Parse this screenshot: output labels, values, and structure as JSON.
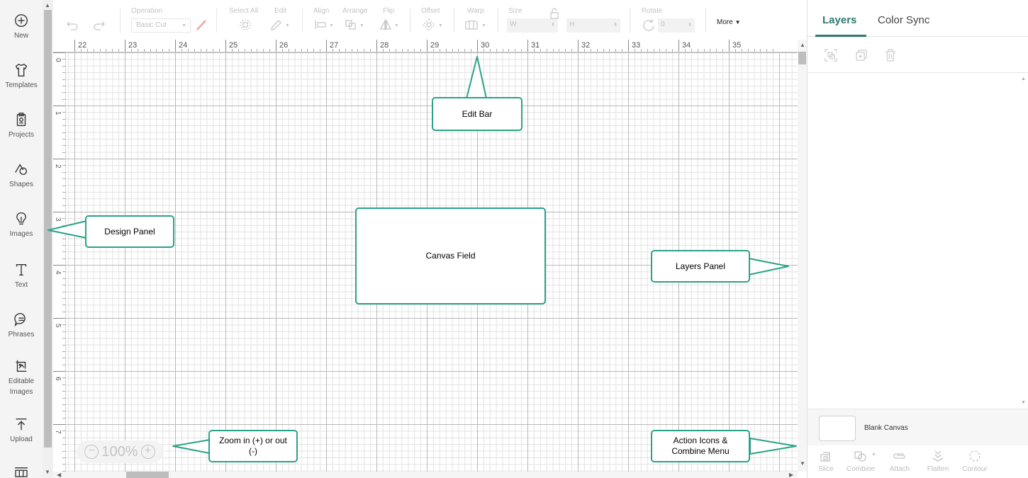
{
  "sidebar": {
    "items": [
      {
        "label": "New",
        "icon": "plus-circle-icon"
      },
      {
        "label": "Templates",
        "icon": "tshirt-icon"
      },
      {
        "label": "Projects",
        "icon": "clipboard-icon"
      },
      {
        "label": "Shapes",
        "icon": "shapes-icon"
      },
      {
        "label": "Images",
        "icon": "lightbulb-icon"
      },
      {
        "label": "Text",
        "icon": "text-icon"
      },
      {
        "label": "Phrases",
        "icon": "speech-bubble-icon"
      },
      {
        "label": "Editable Images",
        "icon": "editable-image-icon"
      },
      {
        "label": "Upload",
        "icon": "upload-icon"
      }
    ]
  },
  "toolbar": {
    "operation_label": "Operation",
    "operation_value": "Basic Cut",
    "select_all_label": "Select All",
    "edit_label": "Edit",
    "align_label": "Align",
    "arrange_label": "Arrange",
    "flip_label": "Flip",
    "offset_label": "Offset",
    "warp_label": "Warp",
    "size_label": "Size",
    "w_label": "W",
    "h_label": "H",
    "rotate_label": "Rotate",
    "rotate_value": "0",
    "more_label": "More"
  },
  "ruler": {
    "top_ticks": [
      "22",
      "23",
      "24",
      "25",
      "26",
      "27",
      "28",
      "29",
      "30",
      "31",
      "32",
      "33",
      "34",
      "35"
    ],
    "left_ticks": [
      "0",
      "1",
      "2",
      "3",
      "4",
      "5",
      "6",
      "7"
    ]
  },
  "zoom": {
    "value": "100%",
    "minus": "−",
    "plus": "+"
  },
  "callouts": {
    "edit_bar": "Edit Bar",
    "design_panel": "Design Panel",
    "canvas_field": "Canvas Field",
    "layers_panel": "Layers Panel",
    "zoom": "Zoom in (+) or out (-)",
    "action_icons": "Action Icons & Combine Menu"
  },
  "right_panel": {
    "tabs": {
      "layers": "Layers",
      "color_sync": "Color Sync"
    },
    "blank_canvas": "Blank Canvas",
    "actions": [
      "Slice",
      "Combine",
      "Attach",
      "Flatten",
      "Contour"
    ]
  },
  "colors": {
    "accent": "#2aa287",
    "active_tab": "#2b7a6e",
    "sidebar_bg": "#f4f4f4"
  }
}
